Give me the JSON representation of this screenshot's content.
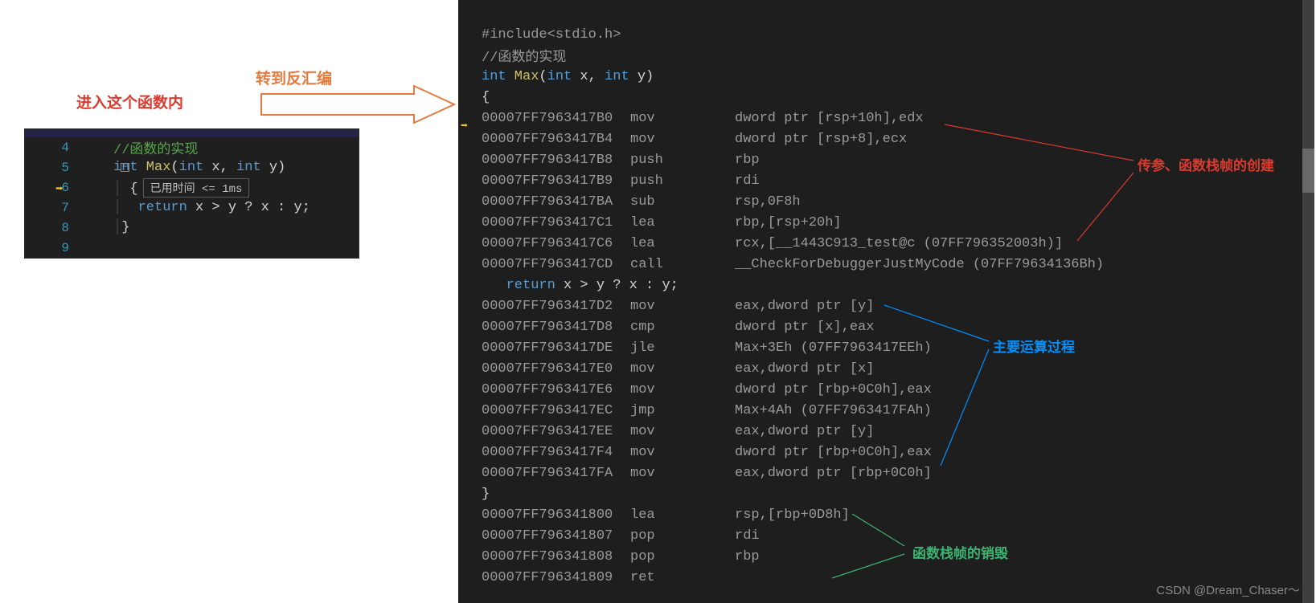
{
  "left": {
    "label": "进入这个函数内",
    "arrowLabel": "转到反汇编",
    "lines": {
      "l4": "//函数的实现",
      "l5_kw1": "int",
      "l5_fn": " Max",
      "l5_open": "(",
      "l5_kw2": "int",
      "l5_p1": " x, ",
      "l5_kw3": "int",
      "l5_p2": " y)",
      "l6": "{",
      "l6_timing": "已用时间 <= 1ms",
      "l7_kw": "return",
      "l7_expr": " x > y ? x : y;",
      "l8": "}"
    },
    "nums": {
      "n4": "4",
      "n5": "5",
      "n6": "6",
      "n7": "7",
      "n8": "8",
      "n9": "9"
    }
  },
  "right": {
    "src_include": "#include<stdio.h>",
    "src_comment": "//函数的实现",
    "src_sig_kw1": "int",
    "src_sig_fn": " Max",
    "src_sig_open": "(",
    "src_sig_kw2": "int",
    "src_sig_p1": " x, ",
    "src_sig_kw3": "int",
    "src_sig_p2": " y)",
    "src_openb": "{",
    "src_return_kw": "return",
    "src_return_expr": " x > y ? x : y;",
    "src_closeb": "}",
    "asm": [
      {
        "a": "00007FF7963417B0",
        "m": "mov",
        "o": "dword ptr [rsp+10h],edx"
      },
      {
        "a": "00007FF7963417B4",
        "m": "mov",
        "o": "dword ptr [rsp+8],ecx"
      },
      {
        "a": "00007FF7963417B8",
        "m": "push",
        "o": "rbp"
      },
      {
        "a": "00007FF7963417B9",
        "m": "push",
        "o": "rdi"
      },
      {
        "a": "00007FF7963417BA",
        "m": "sub",
        "o": "rsp,0F8h"
      },
      {
        "a": "00007FF7963417C1",
        "m": "lea",
        "o": "rbp,[rsp+20h]"
      },
      {
        "a": "00007FF7963417C6",
        "m": "lea",
        "o": "rcx,[__1443C913_test@c (07FF796352003h)]"
      },
      {
        "a": "00007FF7963417CD",
        "m": "call",
        "o": "__CheckForDebuggerJustMyCode (07FF79634136Bh)"
      },
      {
        "a": "00007FF7963417D2",
        "m": "mov",
        "o": "eax,dword ptr [y]"
      },
      {
        "a": "00007FF7963417D8",
        "m": "cmp",
        "o": "dword ptr [x],eax"
      },
      {
        "a": "00007FF7963417DE",
        "m": "jle",
        "o": "Max+3Eh (07FF7963417EEh)"
      },
      {
        "a": "00007FF7963417E0",
        "m": "mov",
        "o": "eax,dword ptr [x]"
      },
      {
        "a": "00007FF7963417E6",
        "m": "mov",
        "o": "dword ptr [rbp+0C0h],eax"
      },
      {
        "a": "00007FF7963417EC",
        "m": "jmp",
        "o": "Max+4Ah (07FF7963417FAh)"
      },
      {
        "a": "00007FF7963417EE",
        "m": "mov",
        "o": "eax,dword ptr [y]"
      },
      {
        "a": "00007FF7963417F4",
        "m": "mov",
        "o": "dword ptr [rbp+0C0h],eax"
      },
      {
        "a": "00007FF7963417FA",
        "m": "mov",
        "o": "eax,dword ptr [rbp+0C0h]"
      },
      {
        "a": "00007FF796341800",
        "m": "lea",
        "o": "rsp,[rbp+0D8h]"
      },
      {
        "a": "00007FF796341807",
        "m": "pop",
        "o": "rdi"
      },
      {
        "a": "00007FF796341808",
        "m": "pop",
        "o": "rbp"
      },
      {
        "a": "00007FF796341809",
        "m": "ret",
        "o": ""
      }
    ]
  },
  "annotations": {
    "red": "传参、函数栈帧的创建",
    "blue": "主要运算过程",
    "green": "函数栈帧的销毁"
  },
  "watermark": "CSDN @Dream_Chaser～"
}
